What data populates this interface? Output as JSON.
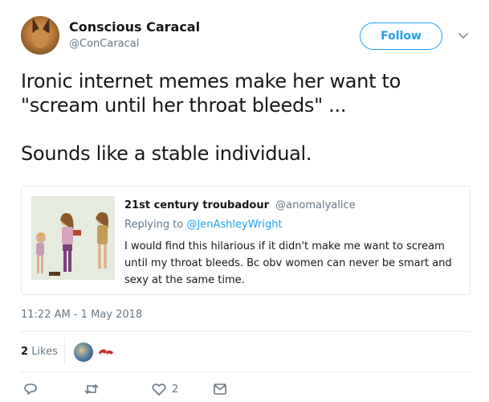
{
  "author": {
    "display_name": "Conscious Caracal",
    "handle": "@ConCaracal",
    "avatar_icon": "caracal-avatar"
  },
  "follow_button": {
    "label": "Follow"
  },
  "menu_icon": "chevron-down-icon",
  "tweet": {
    "lines": [
      "Ironic internet memes make her want to",
      "\"scream until her throat bleeds\" ...",
      "Sounds like a stable individual."
    ]
  },
  "quoted_tweet": {
    "display_name": "21st century troubadour",
    "handle": "@anomalyalice",
    "replying_to_prefix": "Replying to",
    "replying_to_handle": "@JenAshleyWright",
    "body": "I would find this hilarious if it didn't make me want to scream until my throat bleeds. Bc obv women can never be smart and sexy at the same time."
  },
  "timestamp": "11:22 AM - 1 May 2018",
  "likes": {
    "count": "2",
    "label": "Likes"
  },
  "actions": {
    "reply_icon": "reply-icon",
    "retweet_icon": "retweet-icon",
    "like_icon": "heart-icon",
    "like_count": "2",
    "dm_icon": "envelope-icon"
  },
  "colors": {
    "accent": "#1da1f2",
    "secondary_text": "#657786",
    "primary_text": "#14171a",
    "border": "#e1e8ed"
  }
}
